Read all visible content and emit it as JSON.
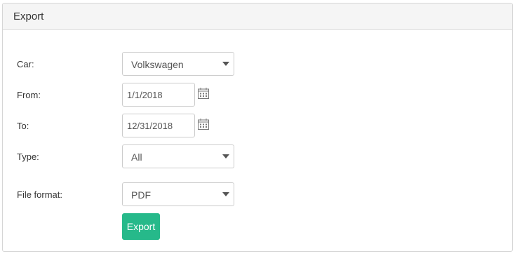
{
  "panel": {
    "title": "Export"
  },
  "form": {
    "car": {
      "label": "Car:",
      "value": "Volkswagen"
    },
    "from": {
      "label": "From:",
      "value": "1/1/2018"
    },
    "to": {
      "label": "To:",
      "value": "12/31/2018"
    },
    "type": {
      "label": "Type:",
      "value": "All"
    },
    "file_format": {
      "label": "File format:",
      "value": "PDF"
    },
    "submit_label": "Export"
  },
  "icons": {
    "calendar": "calendar-icon",
    "dropdown": "chevron-down-icon"
  },
  "colors": {
    "accent": "#26b98a",
    "header_bg": "#f5f5f5",
    "border": "#cccccc"
  }
}
